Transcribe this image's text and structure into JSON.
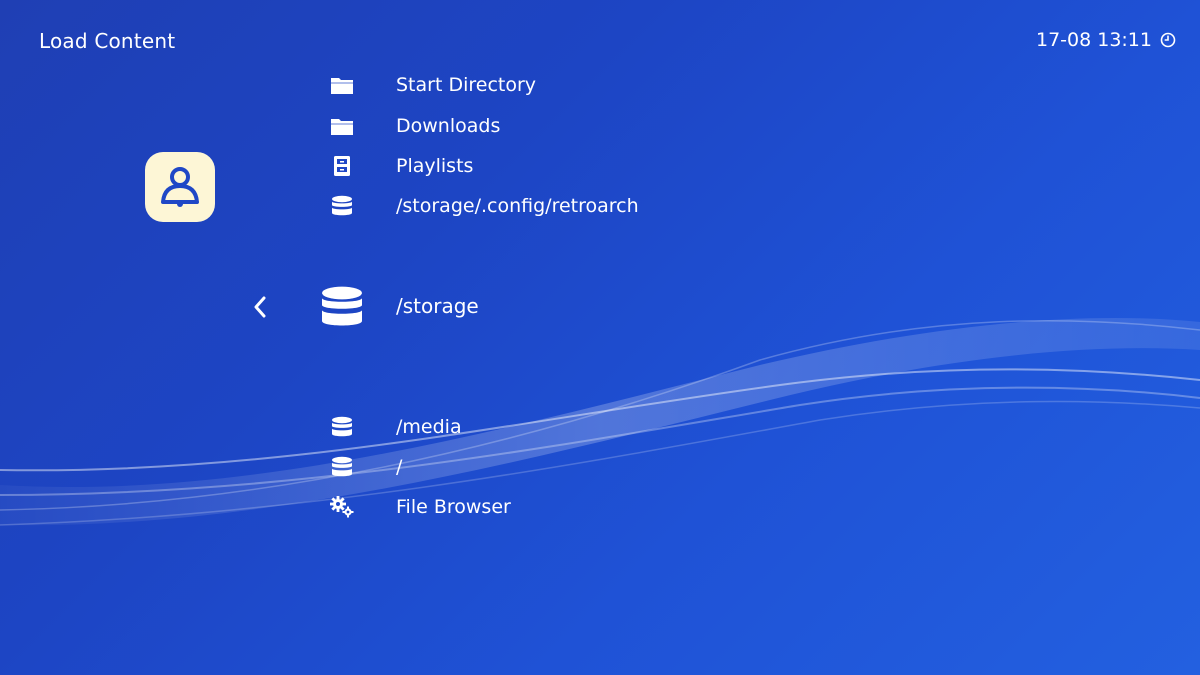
{
  "header": {
    "title": "Load Content",
    "datetime": "17-08 13:11",
    "clock_icon": "clock-icon"
  },
  "badge_icon": "user-badge-icon",
  "menu": {
    "above": [
      {
        "label": "Start Directory",
        "icon": "folder-icon"
      },
      {
        "label": "Downloads",
        "icon": "folder-icon"
      },
      {
        "label": "Playlists",
        "icon": "cabinet-icon"
      },
      {
        "label": "/storage/.config/retroarch",
        "icon": "database-icon"
      }
    ],
    "selected": {
      "label": "/storage",
      "icon": "database-icon"
    },
    "below": [
      {
        "label": "/media",
        "icon": "database-icon"
      },
      {
        "label": "/",
        "icon": "database-icon"
      },
      {
        "label": "File Browser",
        "icon": "gears-icon"
      }
    ]
  },
  "colors": {
    "background": "#1f47c6",
    "text": "#ffffff",
    "badge": "#fdf6d6"
  }
}
